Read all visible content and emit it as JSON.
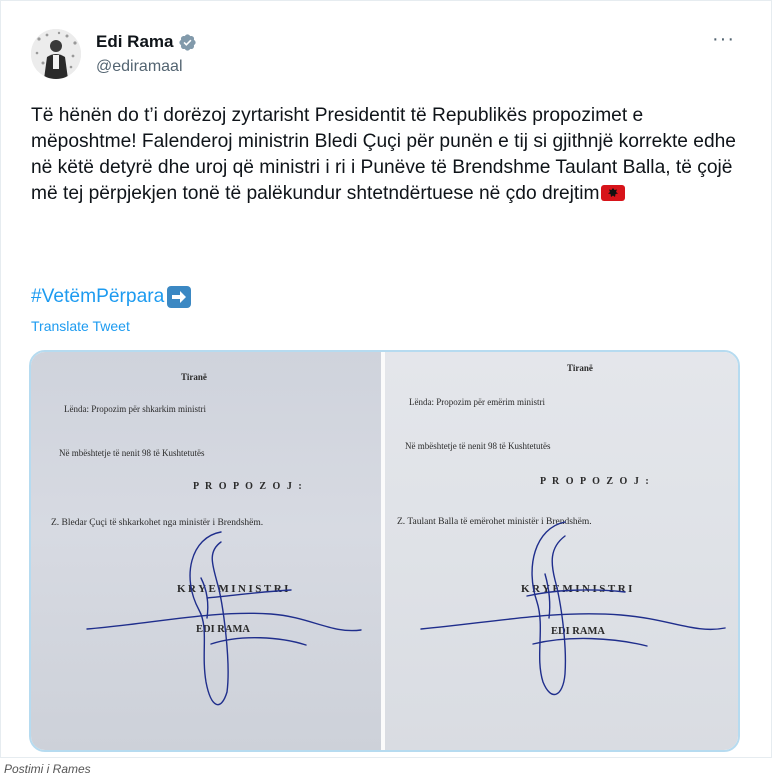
{
  "author": {
    "name": "Edi Rama",
    "handle": "@ediramaal",
    "verified": true,
    "avatar_icon": "avatar-photo"
  },
  "more_label": "···",
  "tweet": {
    "text": "Të hënën do t’i dorëzoj zyrtarisht Presidentit të  Republikës propozimet e mëposhtme! Falenderoj ministrin Bledi Çuçi për punën  e tij si gjithnjë korrekte edhe në këtë detyrë dhe uroj që ministri i ri i Punëve të Brendshme Taulant Balla, të çojë më tej përpjekjen tonë të palëkundur shtetndërtuese në çdo drejtim",
    "flag_icon": "albania-flag-icon",
    "hashtag": "#VetëmPërpara",
    "hashtag_icon": "right-arrow-emoji-icon",
    "translate_label": "Translate Tweet"
  },
  "documents": {
    "left": {
      "city": "Tiranë",
      "subject": "Lënda:  Propozim për shkarkim ministri",
      "basis": "Në mbështetje të nenit 98 të Kushtetutës",
      "propose": "P R O P O Z O J :",
      "decision": "Z. Bledar Çuçi të shkarkohet nga ministër i Brendshëm.",
      "title": "KRYEMINISTRI",
      "signatory": "EDI RAMA"
    },
    "right": {
      "city": "Tiranë",
      "subject": "Lënda:  Propozim për emërim ministri",
      "basis": "Në mbështetje të nenit 98 të Kushtetutës",
      "propose": "P R O P O Z O J :",
      "decision": "Z. Taulant Balla të emërohet ministër i Brendshëm.",
      "title": "KRYEMINISTRI",
      "signatory": "EDI RAMA"
    }
  },
  "caption": "Postimi i Rames",
  "colors": {
    "link": "#1d9bf0",
    "text": "#0f1419",
    "muted": "#536471",
    "verified_badge": "#829aab",
    "ink": "#1f2e8c"
  }
}
